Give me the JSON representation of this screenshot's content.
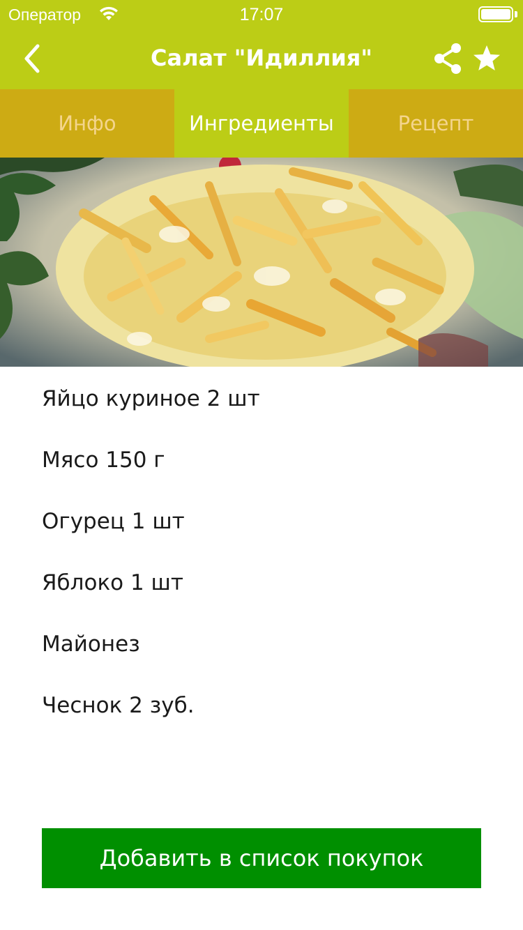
{
  "status_bar": {
    "carrier": "Оператор",
    "time": "17:07",
    "wifi_icon": "wifi-icon",
    "battery_icon": "battery-icon",
    "battery_level": 1.0
  },
  "nav": {
    "title": "Салат \"Идиллия\"",
    "back_icon": "chevron-left-icon",
    "share_icon": "share-icon",
    "favorite_icon": "star-icon"
  },
  "tabs": [
    {
      "label": "Инфо",
      "active": false
    },
    {
      "label": "Ингредиенты",
      "active": true
    },
    {
      "label": "Рецепт",
      "active": false
    }
  ],
  "ingredients": [
    "Яйцо куриное 2 шт",
    "Мясо 150 г",
    "Огурец 1 шт",
    "Яблоко 1 шт",
    "Майонез",
    "Чеснок 2 зуб."
  ],
  "add_button_label": "Добавить в список покупок",
  "colors": {
    "header": "#bccd16",
    "tab_inactive": "#cdab14",
    "tab_inactive_text": "#f4d58d",
    "button": "#008f00"
  }
}
